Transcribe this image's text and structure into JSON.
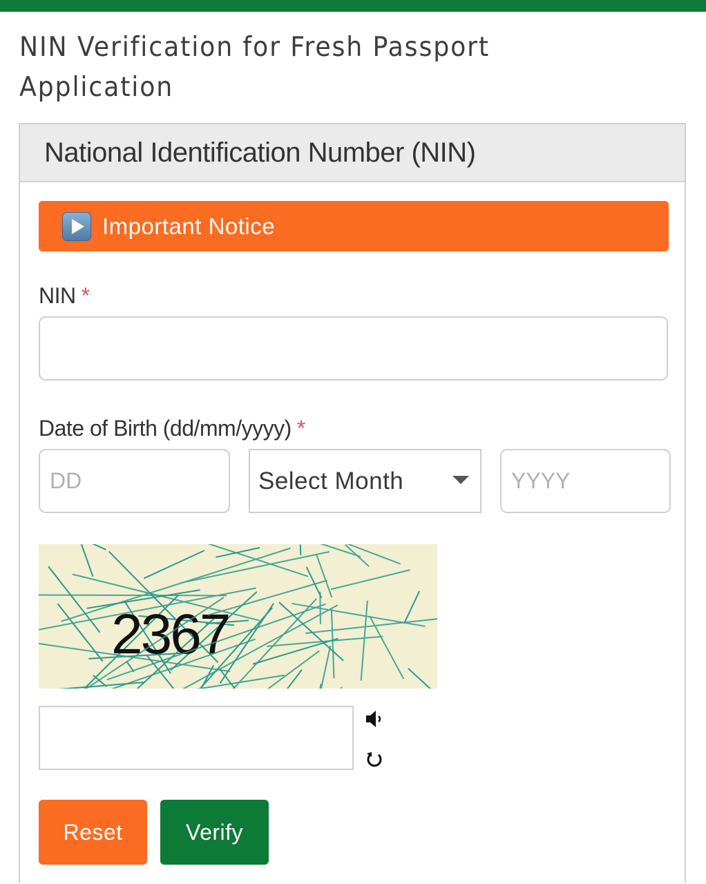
{
  "colors": {
    "brand_green": "#0e7a37",
    "accent_orange": "#f96c22",
    "required_red": "#e05454",
    "captcha_bg": "#f2efd3",
    "captcha_line": "#2a9a8c"
  },
  "page": {
    "title": "NIN Verification for Fresh Passport Application"
  },
  "panel": {
    "heading": "National Identification Number (NIN)",
    "notice": {
      "icon": "play-button-icon",
      "label": "Important Notice"
    }
  },
  "form": {
    "nin": {
      "label": "NIN",
      "required_mark": "*",
      "value": "",
      "placeholder": ""
    },
    "dob": {
      "label": "Date of Birth (dd/mm/yyyy)",
      "required_mark": "*",
      "day": {
        "value": "",
        "placeholder": "DD"
      },
      "month": {
        "selected": "Select Month"
      },
      "year": {
        "value": "",
        "placeholder": "YYYY"
      }
    },
    "captcha": {
      "image_text": "2367",
      "input_value": "",
      "audio_icon": "speaker-icon",
      "refresh_icon": "refresh-icon"
    },
    "buttons": {
      "reset": "Reset",
      "verify": "Verify"
    }
  }
}
